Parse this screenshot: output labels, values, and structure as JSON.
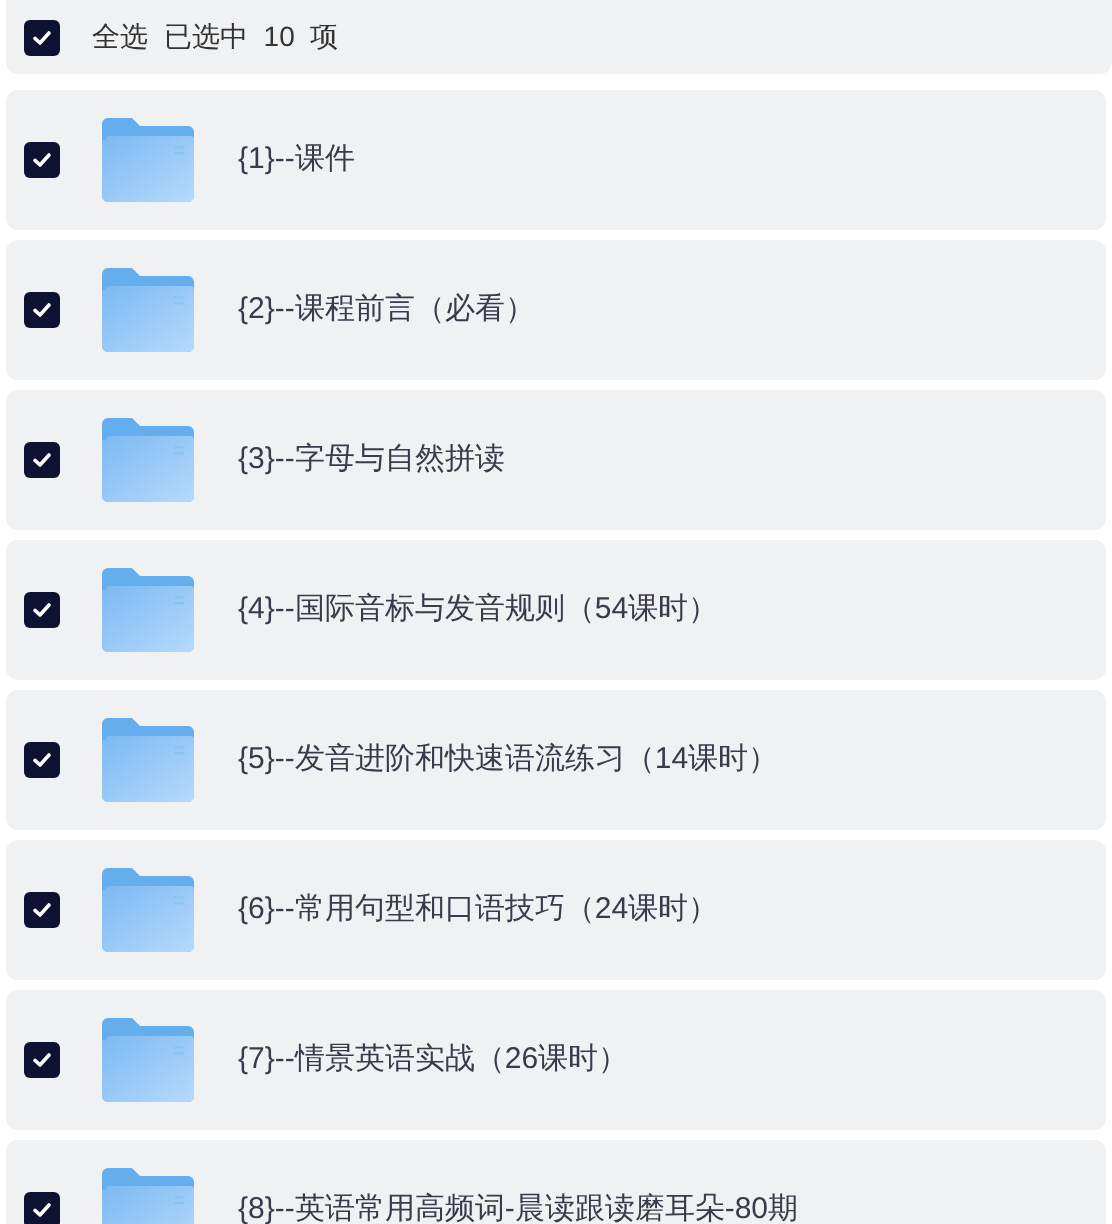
{
  "header": {
    "select_all_checked": true,
    "select_all_label": "全选",
    "selected_count": "已选中  10  项"
  },
  "folders": [
    {
      "name": "{1}--课件",
      "checked": true
    },
    {
      "name": "{2}--课程前言（必看）",
      "checked": true
    },
    {
      "name": "{3}--字母与自然拼读",
      "checked": true
    },
    {
      "name": "{4}--国际音标与发音规则（54课时）",
      "checked": true
    },
    {
      "name": "{5}--发音进阶和快速语流练习（14课时）",
      "checked": true
    },
    {
      "name": "{6}--常用句型和口语技巧（24课时）",
      "checked": true
    },
    {
      "name": "{7}--情景英语实战（26课时）",
      "checked": true
    },
    {
      "name": "{8}--英语常用高频词-晨读跟读磨耳朵-80期",
      "checked": true
    }
  ]
}
